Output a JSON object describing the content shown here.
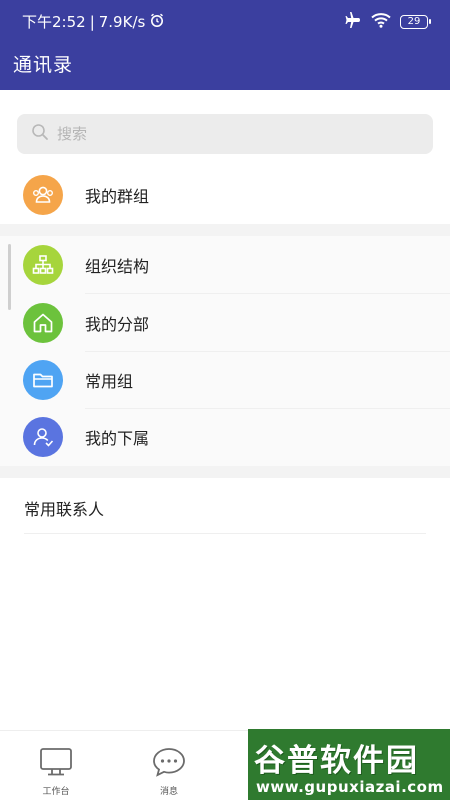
{
  "status_bar": {
    "time": "下午2:52",
    "separator": "|",
    "speed": "7.9K/s",
    "battery": "29"
  },
  "header": {
    "title": "通讯录"
  },
  "search": {
    "placeholder": "搜索"
  },
  "my_groups": {
    "label": "我的群组",
    "icon": "group-icon",
    "color": "#f5a54a"
  },
  "org_items": [
    {
      "label": "组织结构",
      "icon": "org-chart-icon",
      "color": "#a6d53c"
    },
    {
      "label": "我的分部",
      "icon": "home-icon",
      "color": "#6cc23c"
    },
    {
      "label": "常用组",
      "icon": "folder-icon",
      "color": "#4fa4f3"
    },
    {
      "label": "我的下属",
      "icon": "subordinate-icon",
      "color": "#5a74e0"
    }
  ],
  "frequent_contacts": {
    "label": "常用联系人"
  },
  "bottom_nav": [
    {
      "label": "工作台",
      "icon": "workbench-icon"
    },
    {
      "label": "消息",
      "icon": "message-icon"
    }
  ],
  "watermark": {
    "text": "谷普软件园",
    "url": "www.gupuxiazai.com"
  },
  "colors": {
    "header_bg": "#3b3f9f",
    "search_bg": "#ececec",
    "band_bg": "#f3f3f3"
  }
}
